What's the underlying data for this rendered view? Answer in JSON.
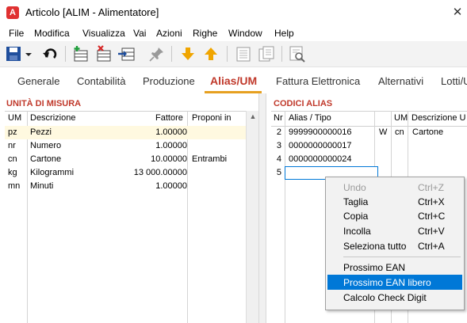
{
  "window": {
    "title": "Articolo [ALIM - Alimentatore]",
    "app_icon": "A",
    "close_glyph": "✕"
  },
  "menu": [
    "File",
    "Modifica",
    "Visualizza",
    "Vai",
    "Azioni",
    "Righe",
    "Window",
    "Help"
  ],
  "toolbar": {
    "icons": [
      "save-icon",
      "dropdown-arrow-icon",
      "undo-icon",
      "add-row-icon",
      "delete-row-icon",
      "insert-row-icon",
      "pin-icon",
      "move-down-icon",
      "move-up-icon",
      "page-icon",
      "copy-page-icon",
      "preview-search-icon"
    ]
  },
  "tabs": [
    "Generale",
    "Contabilità",
    "Produzione",
    "Alias/UM",
    "Fattura Elettronica",
    "Alternativi",
    "Lotti/U"
  ],
  "active_tab": "Alias/UM",
  "units": {
    "title": "UNITÀ DI MISURA",
    "columns": [
      "UM",
      "Descrizione",
      "Fattore",
      "Proponi in"
    ],
    "rows": [
      {
        "um": "pz",
        "descrizione": "Pezzi",
        "fattore": "1.00000",
        "proponi": ""
      },
      {
        "um": "nr",
        "descrizione": "Numero",
        "fattore": "1.00000",
        "proponi": ""
      },
      {
        "um": "cn",
        "descrizione": "Cartone",
        "fattore": "10.00000",
        "proponi": "Entrambi"
      },
      {
        "um": "kg",
        "descrizione": "Kilogrammi",
        "fattore": "13 000.00000",
        "proponi": ""
      },
      {
        "um": "mn",
        "descrizione": "Minuti",
        "fattore": "1.00000",
        "proponi": ""
      }
    ]
  },
  "alias": {
    "title": "CODICI ALIAS",
    "columns": [
      "Nr",
      "Alias / Tipo",
      "",
      "UM",
      "Descrizione U"
    ],
    "rows": [
      {
        "nr": "2",
        "alias": "9999900000016",
        "tipo": "W",
        "um": "cn",
        "descrizione": "Cartone"
      },
      {
        "nr": "3",
        "alias": "0000000000017",
        "tipo": "",
        "um": "",
        "descrizione": ""
      },
      {
        "nr": "4",
        "alias": "0000000000024",
        "tipo": "",
        "um": "",
        "descrizione": ""
      },
      {
        "nr": "5",
        "alias": "",
        "tipo": "",
        "um": "",
        "descrizione": ""
      }
    ]
  },
  "context_menu": {
    "items": [
      {
        "label": "Undo",
        "shortcut": "Ctrl+Z",
        "enabled": false
      },
      {
        "label": "Taglia",
        "shortcut": "Ctrl+X",
        "enabled": true
      },
      {
        "label": "Copia",
        "shortcut": "Ctrl+C",
        "enabled": true
      },
      {
        "label": "Incolla",
        "shortcut": "Ctrl+V",
        "enabled": true
      },
      {
        "label": "Seleziona tutto",
        "shortcut": "Ctrl+A",
        "enabled": true
      },
      {
        "label": "Prossimo EAN",
        "shortcut": "",
        "enabled": true
      },
      {
        "label": "Prossimo EAN libero",
        "shortcut": "",
        "enabled": true,
        "highlighted": true
      },
      {
        "label": "Calcolo Check Digit",
        "shortcut": "",
        "enabled": true
      }
    ]
  },
  "colors": {
    "accent": "#c0392b",
    "tab_underline": "#e6a020",
    "highlight": "#0078d7",
    "selected_row": "#fff9e0"
  }
}
